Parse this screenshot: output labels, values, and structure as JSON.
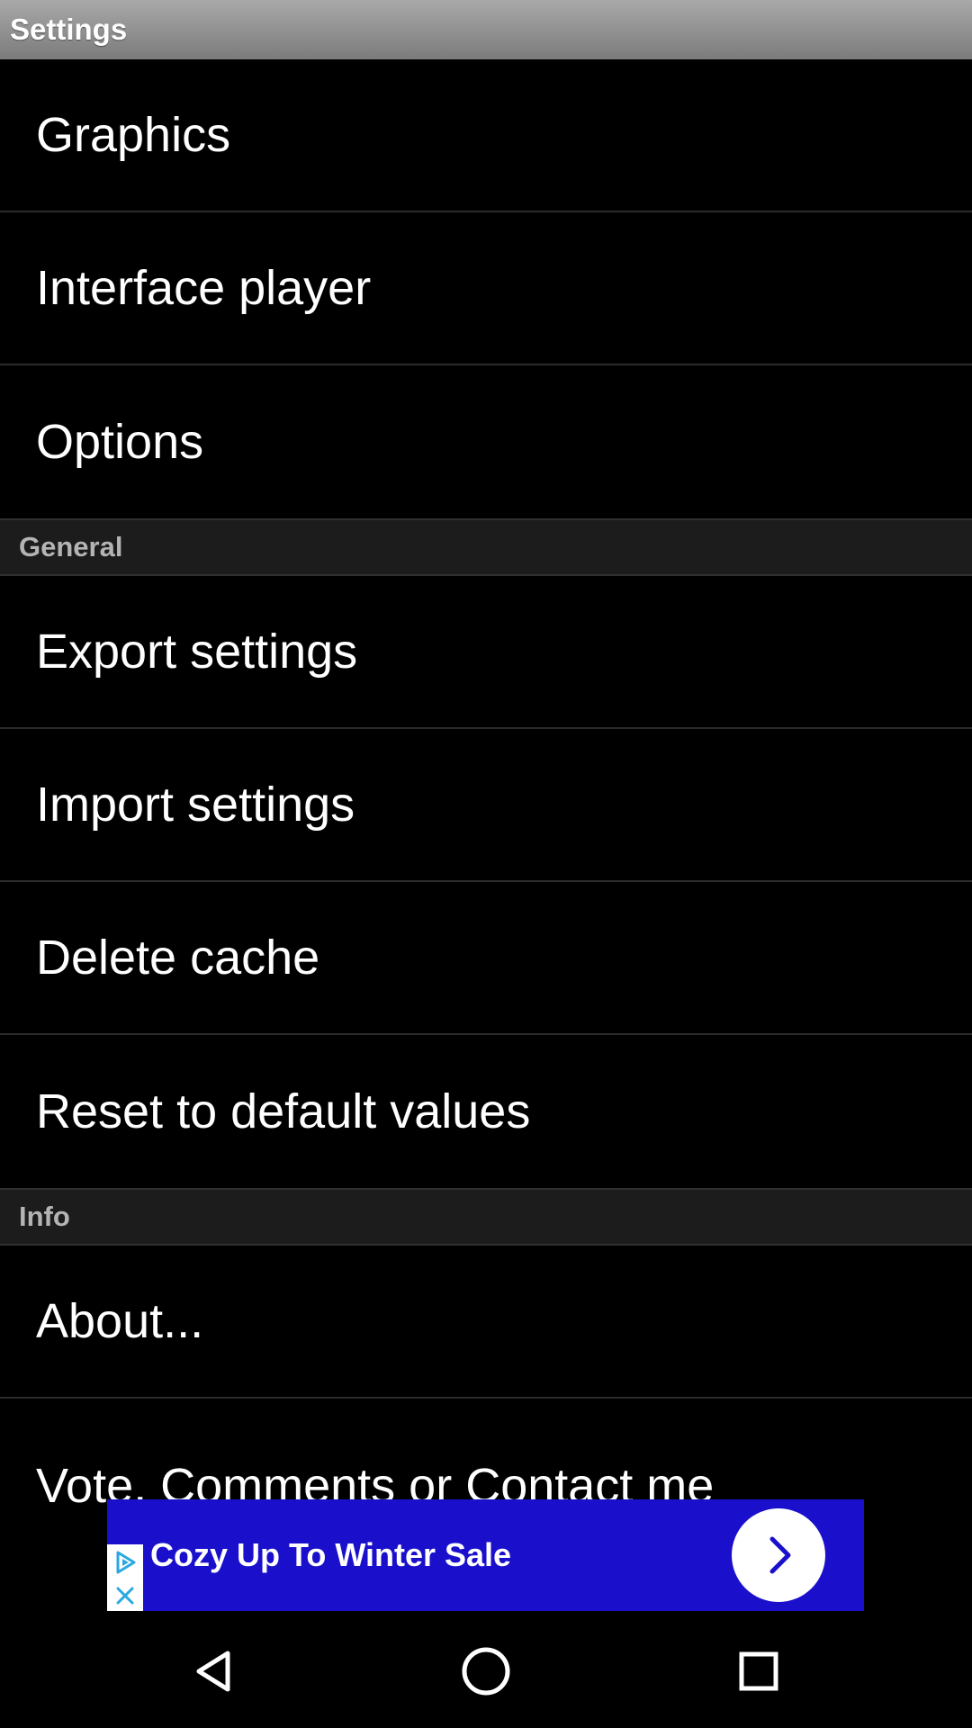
{
  "titlebar": {
    "title": "Settings"
  },
  "list": {
    "items_top": [
      {
        "label": "Graphics"
      },
      {
        "label": "Interface player"
      },
      {
        "label": "Options"
      }
    ],
    "general_header": "General",
    "items_general": [
      {
        "label": "Export settings"
      },
      {
        "label": "Import settings"
      },
      {
        "label": "Delete cache"
      },
      {
        "label": "Reset to default values"
      }
    ],
    "info_header": "Info",
    "items_info": [
      {
        "label": "About..."
      },
      {
        "label": "Vote, Comments or Contact me"
      }
    ]
  },
  "ad": {
    "text": "Cozy Up To Winter Sale",
    "background_color": "#1a10cc",
    "arrow_icon": "chevron-right-icon",
    "adchoices_icon": "play-triangle-icon",
    "close_icon": "close-icon"
  },
  "navbar": {
    "back_icon": "back-triangle-icon",
    "home_icon": "home-circle-icon",
    "recents_icon": "recents-square-icon"
  }
}
